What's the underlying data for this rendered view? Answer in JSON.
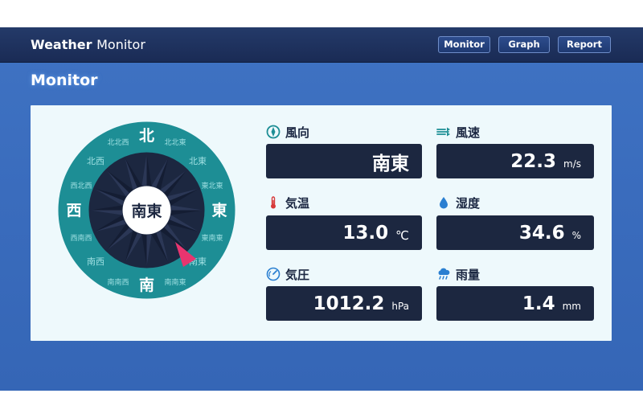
{
  "app": {
    "title_bold": "Weather",
    "title_rest": "Monitor"
  },
  "nav": [
    {
      "label": "Monitor"
    },
    {
      "label": "Graph"
    },
    {
      "label": "Report"
    }
  ],
  "page": {
    "title": "Monitor"
  },
  "compass": {
    "center": "南東",
    "cardinal": {
      "n": "北",
      "e": "東",
      "s": "南",
      "w": "西"
    },
    "minor": {
      "nnw": "北北西",
      "nne": "北北東",
      "nw": "北西",
      "ne": "北東",
      "wnw": "西北西",
      "ene": "東北東",
      "wsw": "西南西",
      "ese": "東南東",
      "sw": "南西",
      "se": "南東",
      "ssw": "南南西",
      "sse": "南南東"
    },
    "direction_label": "南東",
    "pointer_color": "#e8356f",
    "ring_color": "#1d8e95",
    "dial_color": "#1c2740"
  },
  "metrics": {
    "wind_dir": {
      "label": "風向",
      "value": "南東",
      "unit": "",
      "icon": "compass-icon"
    },
    "wind_speed": {
      "label": "風速",
      "value": "22.3",
      "unit": "m/s",
      "icon": "wind-icon"
    },
    "temperature": {
      "label": "気温",
      "value": "13.0",
      "unit": "℃",
      "icon": "thermometer-icon"
    },
    "humidity": {
      "label": "湿度",
      "value": "34.6",
      "unit": "%",
      "icon": "droplet-icon"
    },
    "pressure": {
      "label": "気圧",
      "value": "1012.2",
      "unit": "hPa",
      "icon": "gauge-icon"
    },
    "rainfall": {
      "label": "雨量",
      "value": "1.4",
      "unit": "mm",
      "icon": "rain-cloud-icon"
    }
  },
  "colors": {
    "accent_teal": "#1d8e95",
    "dark_box": "#1c2740",
    "temp_red": "#d73a3a",
    "water_blue": "#2a7fd1"
  }
}
